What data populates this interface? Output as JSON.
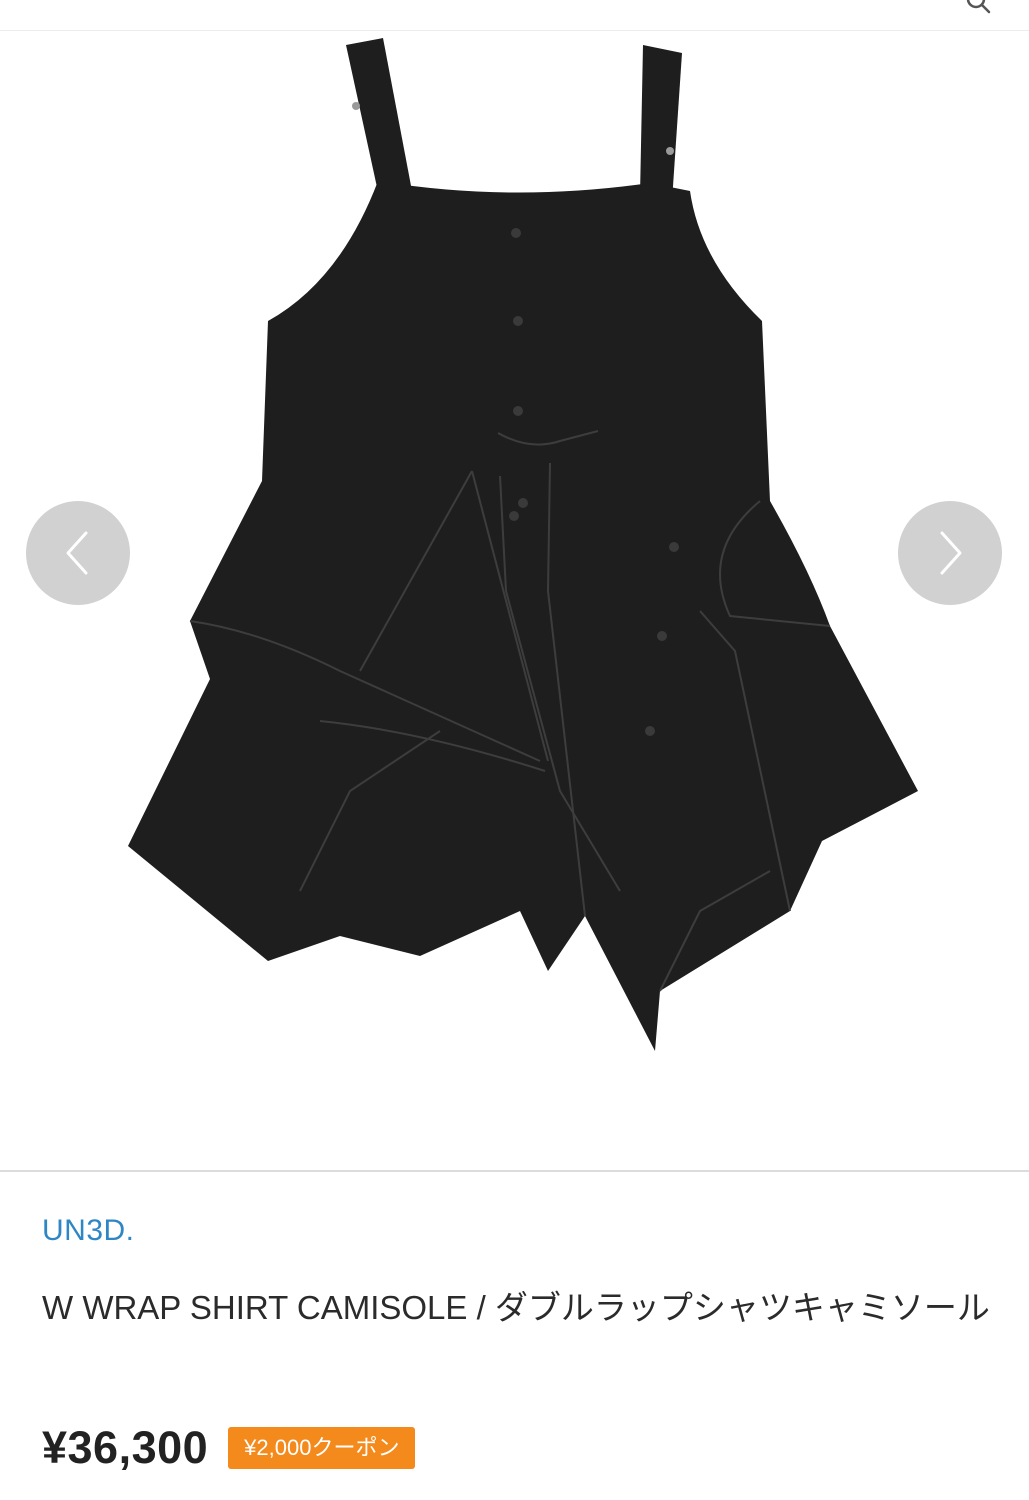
{
  "header": {
    "icon": "search-icon"
  },
  "gallery": {
    "prev_icon": "chevron-left-icon",
    "next_icon": "chevron-right-icon"
  },
  "product": {
    "brand": "UN3D.",
    "title": "W WRAP SHIRT CAMISOLE / ダブルラップシャツキャミソール",
    "price": "¥36,300",
    "coupon": "¥2,000クーポン"
  },
  "colors": {
    "brand_link": "#2f86c4",
    "coupon_bg": "#f48a1c",
    "garment": "#1e1e1e"
  }
}
